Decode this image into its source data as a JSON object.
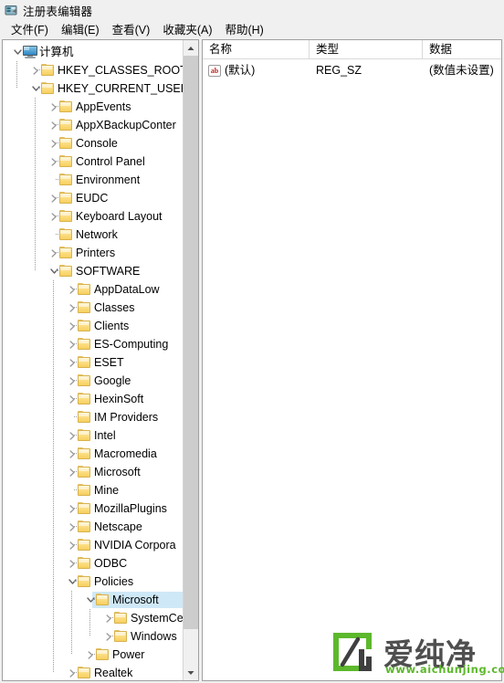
{
  "window": {
    "title": "注册表编辑器",
    "icon": "registry-editor-icon"
  },
  "menu": {
    "items": [
      {
        "label": "文件(F)",
        "name": "menu-file"
      },
      {
        "label": "编辑(E)",
        "name": "menu-edit"
      },
      {
        "label": "查看(V)",
        "name": "menu-view"
      },
      {
        "label": "收藏夹(A)",
        "name": "menu-favorites"
      },
      {
        "label": "帮助(H)",
        "name": "menu-help"
      }
    ]
  },
  "tree": {
    "scrollbar": {
      "up_arrow": "▲",
      "down_arrow": "▼"
    },
    "nodes": [
      {
        "label": "计算机",
        "level": 0,
        "state": "expanded",
        "icon": "computer-icon",
        "selected": false
      },
      {
        "label": "HKEY_CLASSES_ROOT",
        "level": 1,
        "state": "collapsed",
        "icon": "folder-icon",
        "selected": false
      },
      {
        "label": "HKEY_CURRENT_USER",
        "level": 1,
        "state": "expanded",
        "icon": "folder-icon",
        "selected": false
      },
      {
        "label": "AppEvents",
        "level": 2,
        "state": "collapsed",
        "icon": "folder-icon",
        "selected": false
      },
      {
        "label": "AppXBackupConter",
        "level": 2,
        "state": "collapsed",
        "icon": "folder-icon",
        "selected": false
      },
      {
        "label": "Console",
        "level": 2,
        "state": "collapsed",
        "icon": "folder-icon",
        "selected": false
      },
      {
        "label": "Control Panel",
        "level": 2,
        "state": "collapsed",
        "icon": "folder-icon",
        "selected": false
      },
      {
        "label": "Environment",
        "level": 2,
        "state": "leaf",
        "icon": "folder-icon",
        "selected": false
      },
      {
        "label": "EUDC",
        "level": 2,
        "state": "collapsed",
        "icon": "folder-icon",
        "selected": false
      },
      {
        "label": "Keyboard Layout",
        "level": 2,
        "state": "collapsed",
        "icon": "folder-icon",
        "selected": false
      },
      {
        "label": "Network",
        "level": 2,
        "state": "leaf",
        "icon": "folder-icon",
        "selected": false
      },
      {
        "label": "Printers",
        "level": 2,
        "state": "collapsed",
        "icon": "folder-icon",
        "selected": false
      },
      {
        "label": "SOFTWARE",
        "level": 2,
        "state": "expanded",
        "icon": "folder-icon",
        "selected": false
      },
      {
        "label": "AppDataLow",
        "level": 3,
        "state": "collapsed",
        "icon": "folder-icon",
        "selected": false
      },
      {
        "label": "Classes",
        "level": 3,
        "state": "collapsed",
        "icon": "folder-icon",
        "selected": false
      },
      {
        "label": "Clients",
        "level": 3,
        "state": "collapsed",
        "icon": "folder-icon",
        "selected": false
      },
      {
        "label": "ES-Computing",
        "level": 3,
        "state": "collapsed",
        "icon": "folder-icon",
        "selected": false
      },
      {
        "label": "ESET",
        "level": 3,
        "state": "collapsed",
        "icon": "folder-icon",
        "selected": false
      },
      {
        "label": "Google",
        "level": 3,
        "state": "collapsed",
        "icon": "folder-icon",
        "selected": false
      },
      {
        "label": "HexinSoft",
        "level": 3,
        "state": "collapsed",
        "icon": "folder-icon",
        "selected": false
      },
      {
        "label": "IM Providers",
        "level": 3,
        "state": "leaf",
        "icon": "folder-icon",
        "selected": false
      },
      {
        "label": "Intel",
        "level": 3,
        "state": "collapsed",
        "icon": "folder-icon",
        "selected": false
      },
      {
        "label": "Macromedia",
        "level": 3,
        "state": "collapsed",
        "icon": "folder-icon",
        "selected": false
      },
      {
        "label": "Microsoft",
        "level": 3,
        "state": "collapsed",
        "icon": "folder-icon",
        "selected": false
      },
      {
        "label": "Mine",
        "level": 3,
        "state": "leaf",
        "icon": "folder-icon",
        "selected": false
      },
      {
        "label": "MozillaPlugins",
        "level": 3,
        "state": "collapsed",
        "icon": "folder-icon",
        "selected": false
      },
      {
        "label": "Netscape",
        "level": 3,
        "state": "collapsed",
        "icon": "folder-icon",
        "selected": false
      },
      {
        "label": "NVIDIA Corpora",
        "level": 3,
        "state": "collapsed",
        "icon": "folder-icon",
        "selected": false
      },
      {
        "label": "ODBC",
        "level": 3,
        "state": "collapsed",
        "icon": "folder-icon",
        "selected": false
      },
      {
        "label": "Policies",
        "level": 3,
        "state": "expanded",
        "icon": "folder-icon",
        "selected": false
      },
      {
        "label": "Microsoft",
        "level": 4,
        "state": "expanded",
        "icon": "folder-icon",
        "selected": true
      },
      {
        "label": "SystemCe",
        "level": 5,
        "state": "collapsed",
        "icon": "folder-icon",
        "selected": false
      },
      {
        "label": "Windows",
        "level": 5,
        "state": "collapsed",
        "icon": "folder-icon",
        "selected": false
      },
      {
        "label": "Power",
        "level": 4,
        "state": "collapsed",
        "icon": "folder-icon",
        "selected": false
      },
      {
        "label": "Realtek",
        "level": 3,
        "state": "collapsed",
        "icon": "folder-icon",
        "selected": false
      }
    ]
  },
  "values": {
    "columns": [
      {
        "label": "名称",
        "name": "column-name"
      },
      {
        "label": "类型",
        "name": "column-type"
      },
      {
        "label": "数据",
        "name": "column-data"
      }
    ],
    "rows": [
      {
        "icon": "string-value-icon",
        "icon_text": "ab",
        "name": "(默认)",
        "type": "REG_SZ",
        "data": "(数值未设置)"
      }
    ]
  },
  "watermark": {
    "brand": "爱纯净",
    "url": "www.aichunjing.com",
    "accent": "#5cb82c"
  }
}
